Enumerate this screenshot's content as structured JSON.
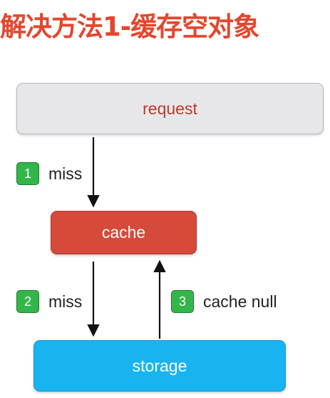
{
  "title": "解决方法1-缓存空对象",
  "nodes": {
    "request": "request",
    "cache": "cache",
    "storage": "storage"
  },
  "steps": [
    {
      "number": "1",
      "label": "miss"
    },
    {
      "number": "2",
      "label": "miss"
    },
    {
      "number": "3",
      "label": "cache null"
    }
  ],
  "colors": {
    "title": "#e4472e",
    "request_fill": "#e7e7e9",
    "request_text": "#c0392b",
    "cache_fill": "#d64a3b",
    "storage_fill": "#18b4f2",
    "badge_fill": "#34b54a",
    "box_text_light": "#ffffff",
    "arrow": "#111111"
  }
}
